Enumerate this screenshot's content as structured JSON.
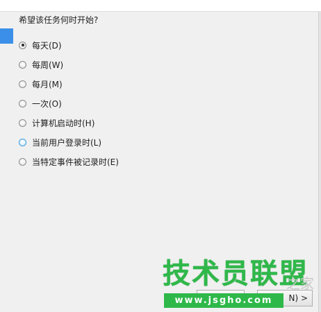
{
  "wizard": {
    "question": "希望该任务何时开始?",
    "selected_index": 0,
    "options": [
      {
        "label": "每天(D)"
      },
      {
        "label": "每周(W)"
      },
      {
        "label": "每月(M)"
      },
      {
        "label": "一次(O)"
      },
      {
        "label": "计算机启动时(H)"
      },
      {
        "label": "当前用户登录时(L)"
      },
      {
        "label": "当特定事件被记录时(E)"
      }
    ]
  },
  "footer": {
    "next_label": "N) >"
  },
  "watermark": {
    "title": "技术员联盟",
    "url": "www.jsgho.com",
    "faint_text": "之家"
  },
  "colors": {
    "nav_marker": "#3b8fe8",
    "watermark_green": "#2fb84a",
    "radio_hover": "#3c9de0"
  }
}
